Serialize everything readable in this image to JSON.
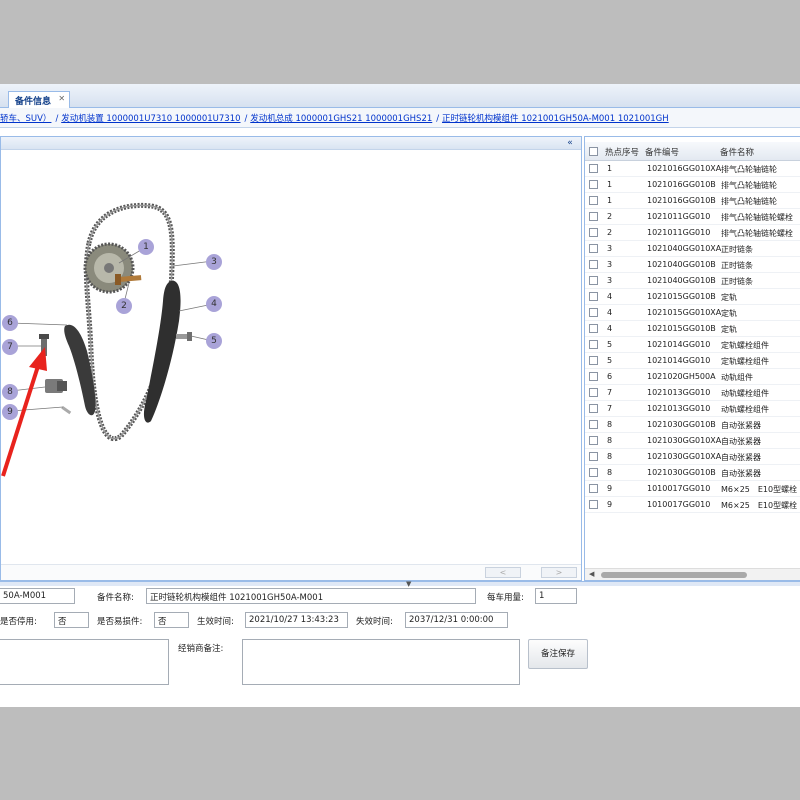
{
  "tabs": [
    {
      "label": "备件信息",
      "close": "✕"
    }
  ],
  "breadcrumbs": [
    {
      "label": "轿车、SUV）"
    },
    {
      "label": "发动机装置 1000001U7310 1000001U7310"
    },
    {
      "label": "发动机总成 1000001GHS21 1000001GHS21"
    },
    {
      "label": "正时链轮机构模组件 1021001GH50A-M001 1021001GH"
    }
  ],
  "panel": {
    "collapse_icon": "«"
  },
  "diagram": {
    "callouts": [
      "1",
      "2",
      "3",
      "4",
      "5",
      "6",
      "7",
      "8",
      "9"
    ],
    "arrow_color": "#e8231d",
    "callout_color": "#a9a3d8"
  },
  "pager": {
    "prev": "<",
    "next": ">"
  },
  "grid": {
    "headers": [
      "热点序号",
      "备件编号",
      "备件名称"
    ],
    "rows": [
      [
        "1",
        "1021016GG010XA",
        "排气凸轮轴链轮"
      ],
      [
        "1",
        "1021016GG010B",
        "排气凸轮轴链轮"
      ],
      [
        "1",
        "1021016GG010B",
        "排气凸轮轴链轮"
      ],
      [
        "2",
        "1021011GG010",
        "排气凸轮轴链轮螺栓"
      ],
      [
        "2",
        "1021011GG010",
        "排气凸轮轴链轮螺栓"
      ],
      [
        "3",
        "1021040GG010XA",
        "正时链条"
      ],
      [
        "3",
        "1021040GG010B",
        "正时链条"
      ],
      [
        "3",
        "1021040GG010B",
        "正时链条"
      ],
      [
        "4",
        "1021015GG010B",
        "定轨"
      ],
      [
        "4",
        "1021015GG010XA",
        "定轨"
      ],
      [
        "4",
        "1021015GG010B",
        "定轨"
      ],
      [
        "5",
        "1021014GG010",
        "定轨螺栓组件"
      ],
      [
        "5",
        "1021014GG010",
        "定轨螺栓组件"
      ],
      [
        "6",
        "1021020GH500A",
        "动轨组件"
      ],
      [
        "7",
        "1021013GG010",
        "动轨螺栓组件"
      ],
      [
        "7",
        "1021013GG010",
        "动轨螺栓组件"
      ],
      [
        "8",
        "1021030GG010B",
        "自动张紧器"
      ],
      [
        "8",
        "1021030GG010XA",
        "自动张紧器"
      ],
      [
        "8",
        "1021030GG010XA",
        "自动张紧器"
      ],
      [
        "8",
        "1021030GG010B",
        "自动张紧器"
      ],
      [
        "9",
        "1010017GG010",
        "M6×25　E10型螺栓"
      ],
      [
        "9",
        "1010017GG010",
        "M6×25　E10型螺栓"
      ]
    ]
  },
  "form": {
    "part_no_value": "50A-M001",
    "part_name_label": "备件名称:",
    "part_name_value": "正时链轮机构模组件 1021001GH50A-M001",
    "qty_label": "每车用量:",
    "qty_value": "1",
    "disabled_label": "是否停用:",
    "disabled_value": "否",
    "wear_label": "是否易损件:",
    "wear_value": "否",
    "effective_label": "生效时间:",
    "effective_value": "2021/10/27 13:43:23",
    "expire_label": "失效时间:",
    "expire_value": "2037/12/31 0:00:00",
    "dealer_note_label": "经销商备注:",
    "save_button": "备注保存"
  }
}
